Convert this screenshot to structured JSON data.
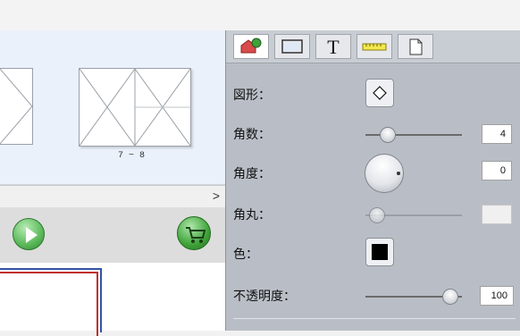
{
  "thumbnails": {
    "page_label": "7 − 8"
  },
  "scroller": {
    "arrow": ">"
  },
  "tabs": [
    {
      "name": "shape-tab"
    },
    {
      "name": "frame-tab"
    },
    {
      "name": "text-tab",
      "glyph": "T"
    },
    {
      "name": "ruler-tab"
    },
    {
      "name": "page-tab"
    }
  ],
  "properties": {
    "shape": {
      "label": "図形："
    },
    "corners": {
      "label": "角数：",
      "value": "4",
      "level": 0.15
    },
    "angle": {
      "label": "角度：",
      "value": "0"
    },
    "rounding": {
      "label": "角丸：",
      "value": "",
      "level": 0.05
    },
    "color": {
      "label": "色：",
      "swatch": "#000000"
    },
    "opacity": {
      "label": "不透明度：",
      "value": "100",
      "level": 1.0
    }
  },
  "colors": {
    "accent_green": "#3fa33a",
    "play_green": "#5bb85a"
  }
}
